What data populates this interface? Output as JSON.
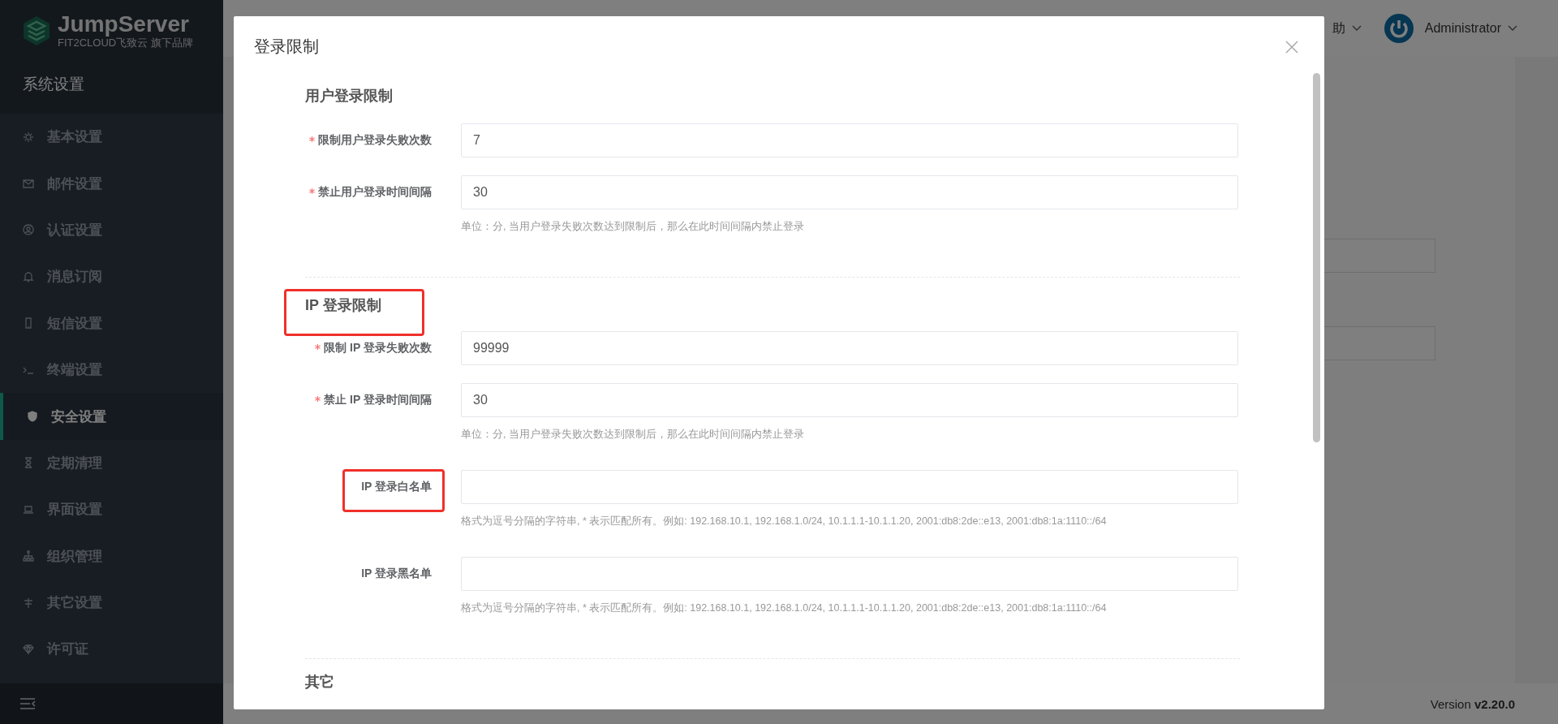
{
  "sidebar": {
    "logo": {
      "name": "JumpServer",
      "tagline": "FIT2CLOUD飞致云 旗下品牌"
    },
    "heading": "系统设置",
    "items": [
      {
        "label": "基本设置",
        "selected": false
      },
      {
        "label": "邮件设置",
        "selected": false
      },
      {
        "label": "认证设置",
        "selected": false
      },
      {
        "label": "消息订阅",
        "selected": false
      },
      {
        "label": "短信设置",
        "selected": false
      },
      {
        "label": "终端设置",
        "selected": false
      },
      {
        "label": "安全设置",
        "selected": true
      },
      {
        "label": "定期清理",
        "selected": false
      },
      {
        "label": "界面设置",
        "selected": false
      },
      {
        "label": "组织管理",
        "selected": false
      },
      {
        "label": "其它设置",
        "selected": false
      },
      {
        "label": "许可证",
        "selected": false
      }
    ]
  },
  "header": {
    "help": "助",
    "user": "Administrator"
  },
  "footer": {
    "version": "Version **v2.20.0**"
  },
  "dialog": {
    "title": "登录限制",
    "sections": [
      {
        "title": "用户登录限制",
        "highlighted": false,
        "fields": [
          {
            "label": "限制用户登录失败次数",
            "required": true,
            "highlighted": false,
            "value": "7"
          },
          {
            "label": "禁止用户登录时间间隔",
            "required": true,
            "highlighted": false,
            "value": "30",
            "help": "单位：分, 当用户登录失败次数达到限制后，那么在此时间间隔内禁止登录"
          }
        ]
      },
      {
        "title": "IP 登录限制",
        "highlighted": true,
        "fields": [
          {
            "label": "限制 IP 登录失败次数",
            "required": true,
            "highlighted": false,
            "value": "99999"
          },
          {
            "label": "禁止 IP 登录时间间隔",
            "required": true,
            "highlighted": false,
            "value": "30",
            "help": "单位：分, 当用户登录失败次数达到限制后，那么在此时间间隔内禁止登录"
          },
          {
            "label": "IP 登录白名单",
            "required": false,
            "highlighted": true,
            "help": "格式为逗号分隔的字符串, * 表示匹配所有。例如: 192.168.10.1, 192.168.1.0/24, 10.1.1.1-10.1.1.20, 2001:db8:2de::e13, 2001:db8:1a:1110::/64"
          },
          {
            "label": "IP 登录黑名单",
            "required": false,
            "highlighted": false,
            "help": "格式为逗号分隔的字符串, * 表示匹配所有。例如: 192.168.10.1, 192.168.1.0/24, 10.1.1.1-10.1.1.20, 2001:db8:2de::e13, 2001:db8:1a:1110::/64"
          }
        ]
      },
      {
        "title": "其它",
        "highlighted": false
      }
    ]
  }
}
